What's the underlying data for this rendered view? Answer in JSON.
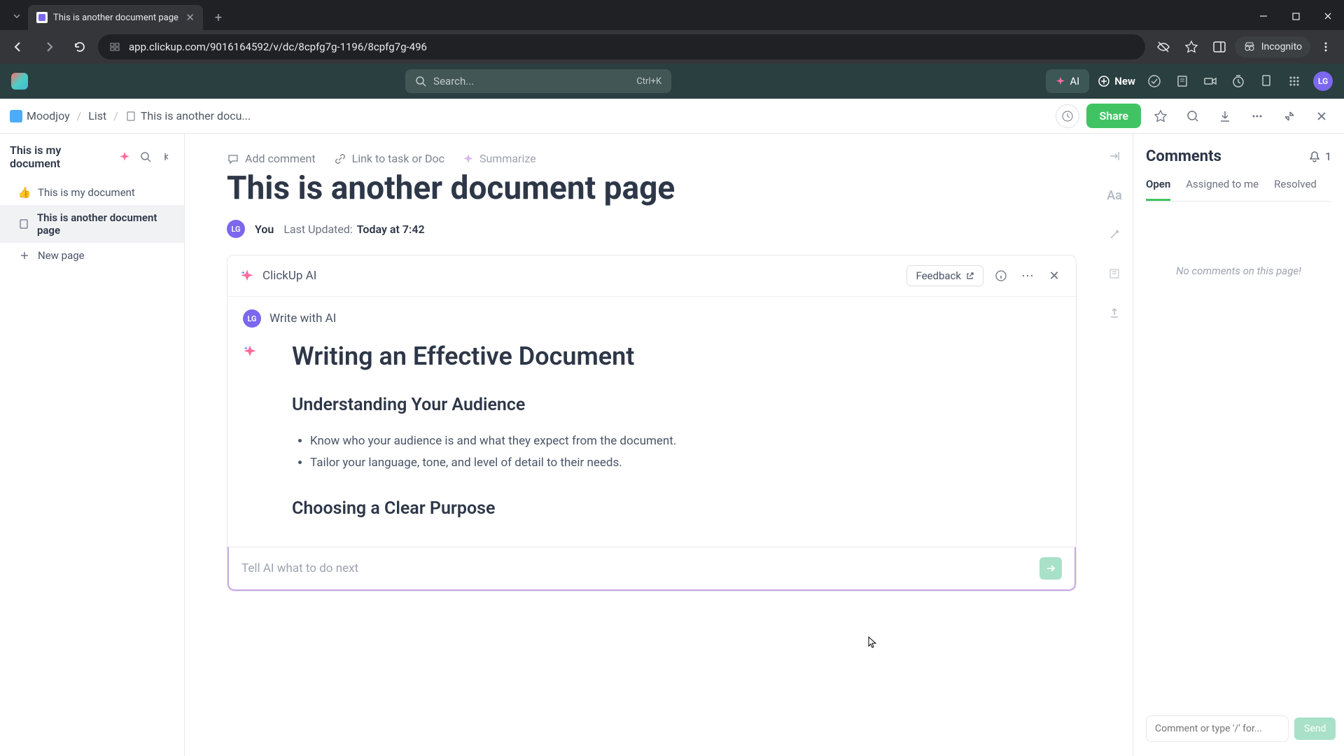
{
  "browser": {
    "tab_title": "This is another document page",
    "url": "app.clickup.com/9016164592/v/dc/8cpfg7g-1196/8cpfg7g-496",
    "incognito_label": "Incognito"
  },
  "appbar": {
    "search_placeholder": "Search...",
    "search_shortcut": "Ctrl+K",
    "ai_label": "AI",
    "new_label": "New",
    "avatar_initials": "LG"
  },
  "breadcrumb": {
    "workspace": "Moodjoy",
    "list": "List",
    "doc": "This is another docu...",
    "share_label": "Share"
  },
  "sidebar": {
    "title": "This is my document",
    "items": [
      {
        "icon": "👍",
        "label": "This is my document"
      },
      {
        "icon": "doc",
        "label": "This is another document page"
      },
      {
        "icon": "plus",
        "label": "New page"
      }
    ]
  },
  "doc": {
    "actions": {
      "add_comment": "Add comment",
      "link_task": "Link to task or Doc",
      "summarize": "Summarize"
    },
    "title": "This is another document page",
    "meta": {
      "avatar": "LG",
      "you": "You",
      "updated_label": "Last Updated:",
      "updated_time": "Today at 7:42"
    }
  },
  "ai": {
    "header_title": "ClickUp AI",
    "feedback_label": "Feedback",
    "user_avatar": "LG",
    "user_prompt": "Write with AI",
    "content": {
      "h1": "Writing an Effective Document",
      "section1_h2": "Understanding Your Audience",
      "section1_bullets": [
        "Know who your audience is and what they expect from the document.",
        "Tailor your language, tone, and level of detail to their needs."
      ],
      "section2_h2": "Choosing a Clear Purpose"
    },
    "input_placeholder": "Tell AI what to do next"
  },
  "comments": {
    "title": "Comments",
    "notif_count": "1",
    "tabs": {
      "open": "Open",
      "assigned": "Assigned to me",
      "resolved": "Resolved"
    },
    "empty": "No comments on this page!",
    "input_placeholder": "Comment or type '/' for...",
    "send_label": "Send"
  }
}
